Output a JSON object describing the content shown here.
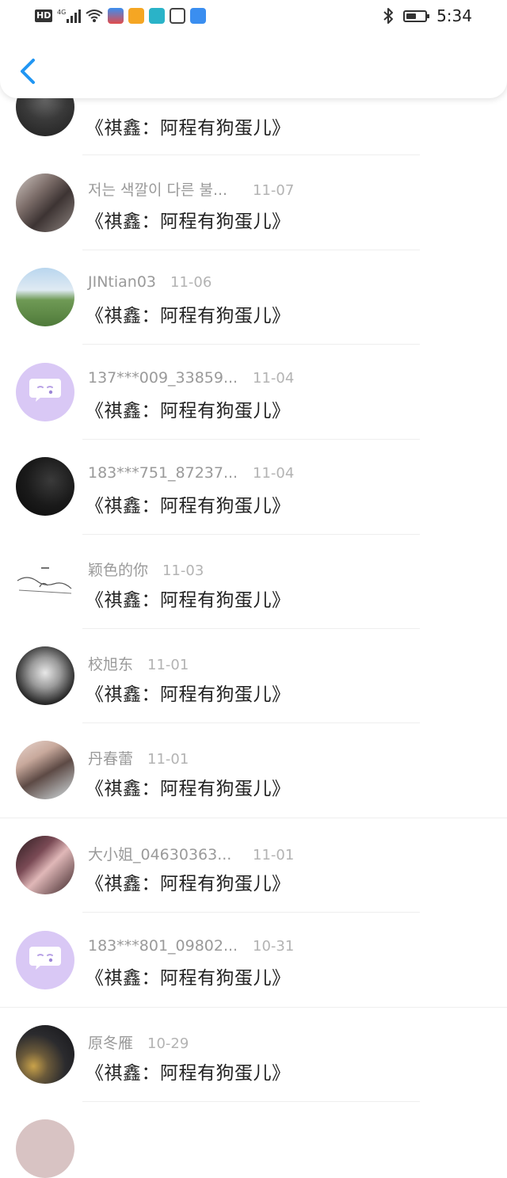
{
  "status_bar": {
    "network": "HD",
    "signal": "4G",
    "time": "5:34",
    "battery_level": 0.55
  },
  "header": {
    "back_icon": "chevron-left-icon",
    "accent_color": "#2196f3"
  },
  "items": [
    {
      "name": "",
      "date": "",
      "title": "《祺鑫：阿程有狗蛋儿》"
    },
    {
      "name": "저는 색깔이 다른 불...",
      "date": "11-07",
      "title": "《祺鑫：阿程有狗蛋儿》"
    },
    {
      "name": "JINtian03",
      "date": "11-06",
      "title": "《祺鑫：阿程有狗蛋儿》"
    },
    {
      "name": "137***009_33859...",
      "date": "11-04",
      "title": "《祺鑫：阿程有狗蛋儿》"
    },
    {
      "name": "183***751_87237...",
      "date": "11-04",
      "title": "《祺鑫：阿程有狗蛋儿》"
    },
    {
      "name": "颖色的你",
      "date": "11-03",
      "title": "《祺鑫：阿程有狗蛋儿》"
    },
    {
      "name": "校旭东",
      "date": "11-01",
      "title": "《祺鑫：阿程有狗蛋儿》"
    },
    {
      "name": "丹春蕾",
      "date": "11-01",
      "title": "《祺鑫：阿程有狗蛋儿》"
    },
    {
      "name": "大小姐_04630363...",
      "date": "11-01",
      "title": "《祺鑫：阿程有狗蛋儿》"
    },
    {
      "name": "183***801_09802...",
      "date": "10-31",
      "title": "《祺鑫：阿程有狗蛋儿》"
    },
    {
      "name": "原冬雁",
      "date": "10-29",
      "title": "《祺鑫：阿程有狗蛋儿》"
    }
  ]
}
